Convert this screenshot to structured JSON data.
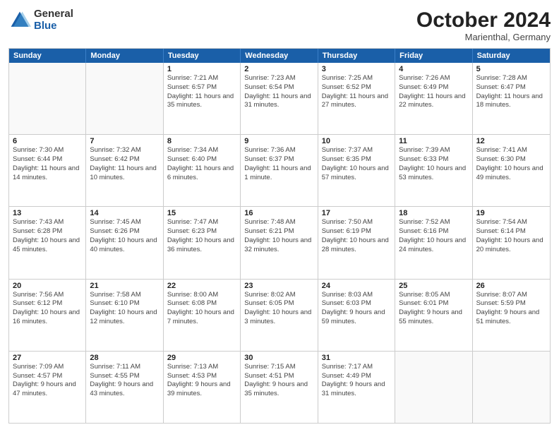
{
  "logo": {
    "general": "General",
    "blue": "Blue"
  },
  "header": {
    "month": "October 2024",
    "location": "Marienthal, Germany"
  },
  "weekdays": [
    "Sunday",
    "Monday",
    "Tuesday",
    "Wednesday",
    "Thursday",
    "Friday",
    "Saturday"
  ],
  "rows": [
    [
      {
        "day": "",
        "sunrise": "",
        "sunset": "",
        "daylight": ""
      },
      {
        "day": "",
        "sunrise": "",
        "sunset": "",
        "daylight": ""
      },
      {
        "day": "1",
        "sunrise": "Sunrise: 7:21 AM",
        "sunset": "Sunset: 6:57 PM",
        "daylight": "Daylight: 11 hours and 35 minutes."
      },
      {
        "day": "2",
        "sunrise": "Sunrise: 7:23 AM",
        "sunset": "Sunset: 6:54 PM",
        "daylight": "Daylight: 11 hours and 31 minutes."
      },
      {
        "day": "3",
        "sunrise": "Sunrise: 7:25 AM",
        "sunset": "Sunset: 6:52 PM",
        "daylight": "Daylight: 11 hours and 27 minutes."
      },
      {
        "day": "4",
        "sunrise": "Sunrise: 7:26 AM",
        "sunset": "Sunset: 6:49 PM",
        "daylight": "Daylight: 11 hours and 22 minutes."
      },
      {
        "day": "5",
        "sunrise": "Sunrise: 7:28 AM",
        "sunset": "Sunset: 6:47 PM",
        "daylight": "Daylight: 11 hours and 18 minutes."
      }
    ],
    [
      {
        "day": "6",
        "sunrise": "Sunrise: 7:30 AM",
        "sunset": "Sunset: 6:44 PM",
        "daylight": "Daylight: 11 hours and 14 minutes."
      },
      {
        "day": "7",
        "sunrise": "Sunrise: 7:32 AM",
        "sunset": "Sunset: 6:42 PM",
        "daylight": "Daylight: 11 hours and 10 minutes."
      },
      {
        "day": "8",
        "sunrise": "Sunrise: 7:34 AM",
        "sunset": "Sunset: 6:40 PM",
        "daylight": "Daylight: 11 hours and 6 minutes."
      },
      {
        "day": "9",
        "sunrise": "Sunrise: 7:36 AM",
        "sunset": "Sunset: 6:37 PM",
        "daylight": "Daylight: 11 hours and 1 minute."
      },
      {
        "day": "10",
        "sunrise": "Sunrise: 7:37 AM",
        "sunset": "Sunset: 6:35 PM",
        "daylight": "Daylight: 10 hours and 57 minutes."
      },
      {
        "day": "11",
        "sunrise": "Sunrise: 7:39 AM",
        "sunset": "Sunset: 6:33 PM",
        "daylight": "Daylight: 10 hours and 53 minutes."
      },
      {
        "day": "12",
        "sunrise": "Sunrise: 7:41 AM",
        "sunset": "Sunset: 6:30 PM",
        "daylight": "Daylight: 10 hours and 49 minutes."
      }
    ],
    [
      {
        "day": "13",
        "sunrise": "Sunrise: 7:43 AM",
        "sunset": "Sunset: 6:28 PM",
        "daylight": "Daylight: 10 hours and 45 minutes."
      },
      {
        "day": "14",
        "sunrise": "Sunrise: 7:45 AM",
        "sunset": "Sunset: 6:26 PM",
        "daylight": "Daylight: 10 hours and 40 minutes."
      },
      {
        "day": "15",
        "sunrise": "Sunrise: 7:47 AM",
        "sunset": "Sunset: 6:23 PM",
        "daylight": "Daylight: 10 hours and 36 minutes."
      },
      {
        "day": "16",
        "sunrise": "Sunrise: 7:48 AM",
        "sunset": "Sunset: 6:21 PM",
        "daylight": "Daylight: 10 hours and 32 minutes."
      },
      {
        "day": "17",
        "sunrise": "Sunrise: 7:50 AM",
        "sunset": "Sunset: 6:19 PM",
        "daylight": "Daylight: 10 hours and 28 minutes."
      },
      {
        "day": "18",
        "sunrise": "Sunrise: 7:52 AM",
        "sunset": "Sunset: 6:16 PM",
        "daylight": "Daylight: 10 hours and 24 minutes."
      },
      {
        "day": "19",
        "sunrise": "Sunrise: 7:54 AM",
        "sunset": "Sunset: 6:14 PM",
        "daylight": "Daylight: 10 hours and 20 minutes."
      }
    ],
    [
      {
        "day": "20",
        "sunrise": "Sunrise: 7:56 AM",
        "sunset": "Sunset: 6:12 PM",
        "daylight": "Daylight: 10 hours and 16 minutes."
      },
      {
        "day": "21",
        "sunrise": "Sunrise: 7:58 AM",
        "sunset": "Sunset: 6:10 PM",
        "daylight": "Daylight: 10 hours and 12 minutes."
      },
      {
        "day": "22",
        "sunrise": "Sunrise: 8:00 AM",
        "sunset": "Sunset: 6:08 PM",
        "daylight": "Daylight: 10 hours and 7 minutes."
      },
      {
        "day": "23",
        "sunrise": "Sunrise: 8:02 AM",
        "sunset": "Sunset: 6:05 PM",
        "daylight": "Daylight: 10 hours and 3 minutes."
      },
      {
        "day": "24",
        "sunrise": "Sunrise: 8:03 AM",
        "sunset": "Sunset: 6:03 PM",
        "daylight": "Daylight: 9 hours and 59 minutes."
      },
      {
        "day": "25",
        "sunrise": "Sunrise: 8:05 AM",
        "sunset": "Sunset: 6:01 PM",
        "daylight": "Daylight: 9 hours and 55 minutes."
      },
      {
        "day": "26",
        "sunrise": "Sunrise: 8:07 AM",
        "sunset": "Sunset: 5:59 PM",
        "daylight": "Daylight: 9 hours and 51 minutes."
      }
    ],
    [
      {
        "day": "27",
        "sunrise": "Sunrise: 7:09 AM",
        "sunset": "Sunset: 4:57 PM",
        "daylight": "Daylight: 9 hours and 47 minutes."
      },
      {
        "day": "28",
        "sunrise": "Sunrise: 7:11 AM",
        "sunset": "Sunset: 4:55 PM",
        "daylight": "Daylight: 9 hours and 43 minutes."
      },
      {
        "day": "29",
        "sunrise": "Sunrise: 7:13 AM",
        "sunset": "Sunset: 4:53 PM",
        "daylight": "Daylight: 9 hours and 39 minutes."
      },
      {
        "day": "30",
        "sunrise": "Sunrise: 7:15 AM",
        "sunset": "Sunset: 4:51 PM",
        "daylight": "Daylight: 9 hours and 35 minutes."
      },
      {
        "day": "31",
        "sunrise": "Sunrise: 7:17 AM",
        "sunset": "Sunset: 4:49 PM",
        "daylight": "Daylight: 9 hours and 31 minutes."
      },
      {
        "day": "",
        "sunrise": "",
        "sunset": "",
        "daylight": ""
      },
      {
        "day": "",
        "sunrise": "",
        "sunset": "",
        "daylight": ""
      }
    ]
  ]
}
